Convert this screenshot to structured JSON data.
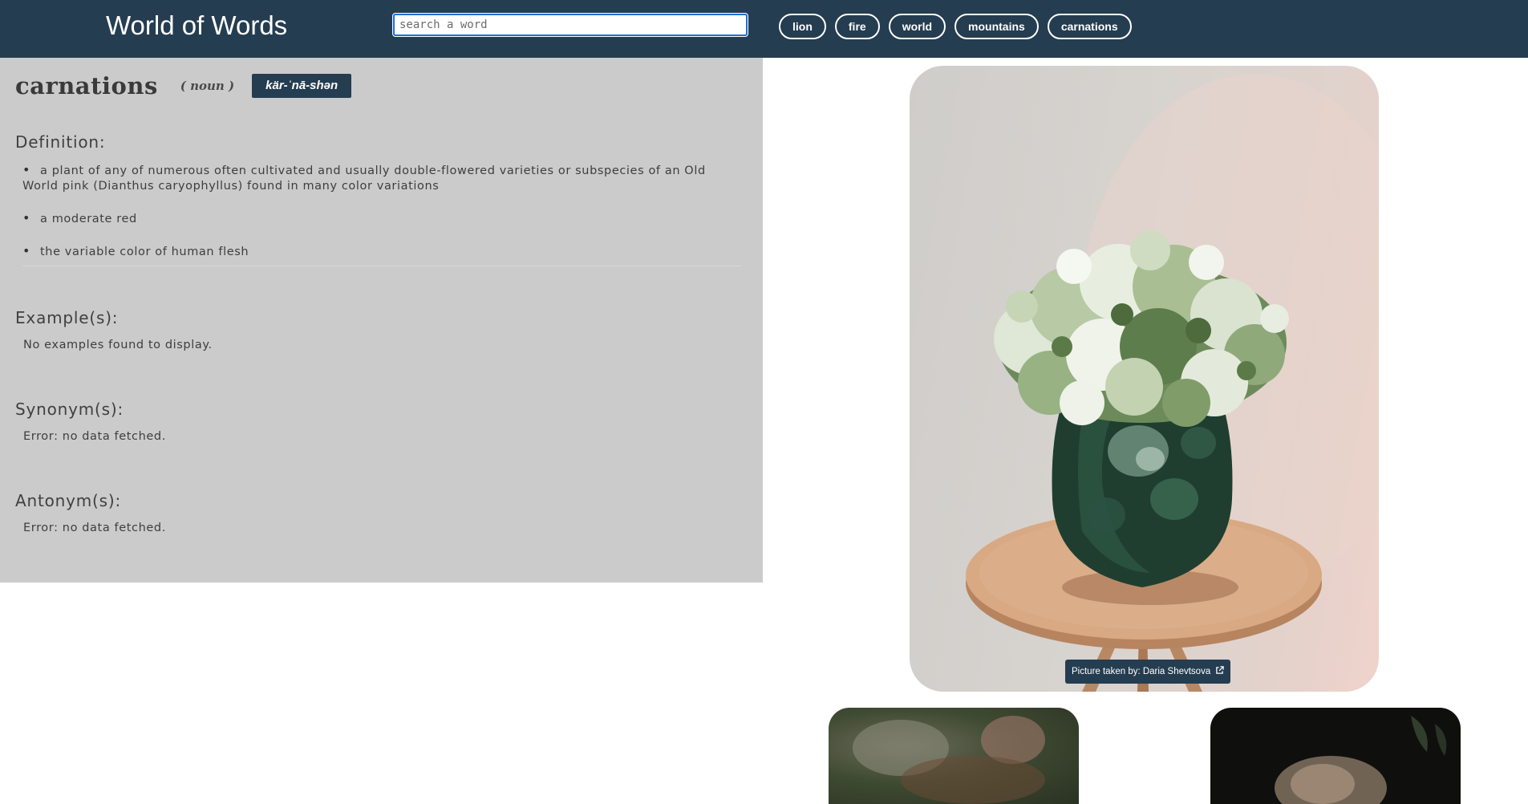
{
  "header": {
    "title": "World of Words",
    "search_placeholder": "search a word",
    "chips": [
      "lion",
      "fire",
      "world",
      "mountains",
      "carnations"
    ]
  },
  "entry": {
    "word": "carnations",
    "part_of_speech": "( noun )",
    "pronunciation": "kär-ˈnā-shən"
  },
  "sections": {
    "definition": {
      "heading": "Definition:",
      "items": [
        "a plant of any of numerous often cultivated and usually double-flowered varieties or subspecies of an Old World pink (Dianthus caryophyllus) found in many color variations",
        "a moderate red",
        "the variable color of human flesh"
      ]
    },
    "examples": {
      "heading": "Example(s):",
      "text": "No examples found to display."
    },
    "synonyms": {
      "heading": "Synonym(s):",
      "text": "Error: no data fetched."
    },
    "antonyms": {
      "heading": "Antonym(s):",
      "text": "Error: no data fetched."
    }
  },
  "photo": {
    "credit": "Picture taken by: Daria Shevtsova",
    "credit_icon": "external-link-icon"
  },
  "colors": {
    "header_bg": "#253d51",
    "panel_bg": "#cbcbcb",
    "chip_border": "#ffffff",
    "search_focus": "#1f6fd6"
  }
}
